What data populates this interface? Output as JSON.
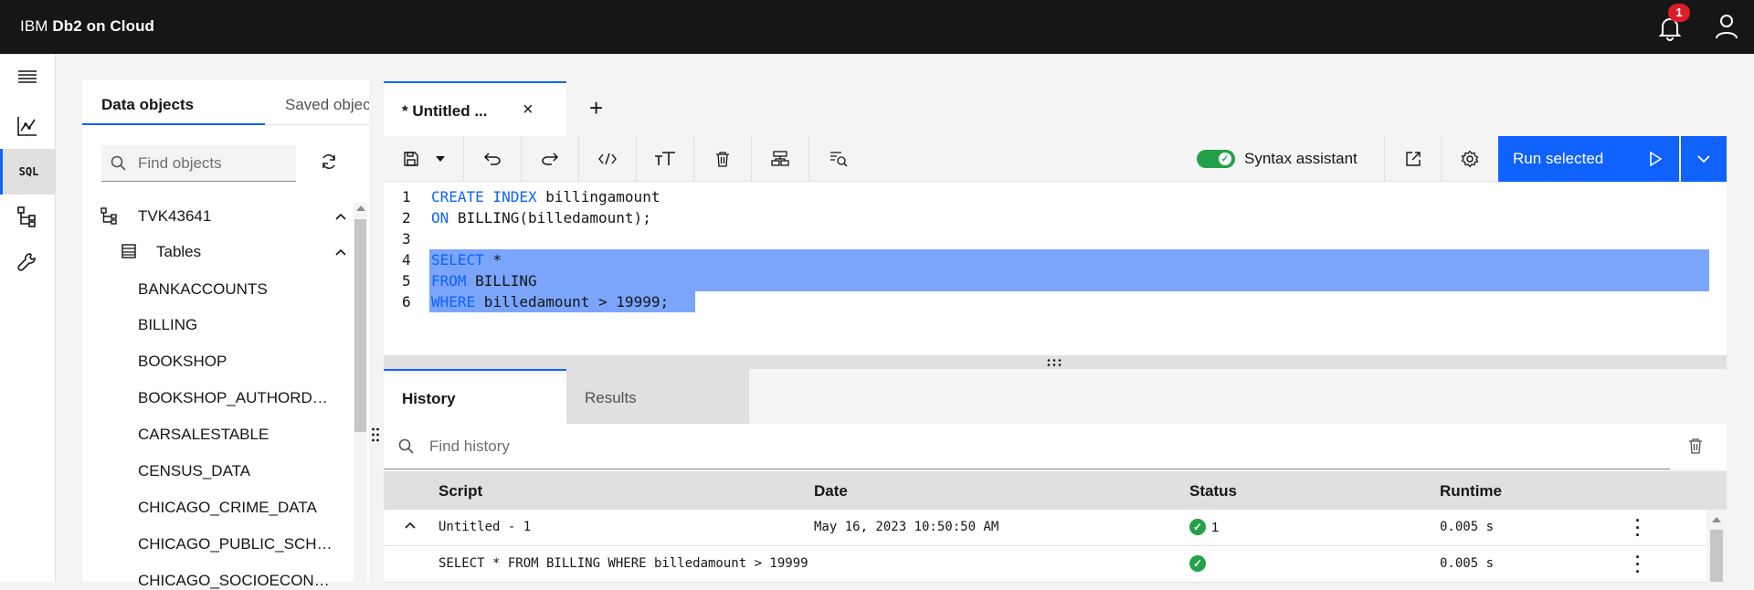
{
  "header": {
    "brand_prefix": "IBM ",
    "brand_bold": "Db2 on Cloud",
    "notification_count": "1"
  },
  "rail": {
    "sql_label": "SQL"
  },
  "left_panel": {
    "tabs": [
      "Data objects",
      "Saved objects"
    ],
    "search_placeholder": "Find objects",
    "schema": "TVK43641",
    "tables_label": "Tables",
    "tables": [
      "BANKACCOUNTS",
      "BILLING",
      "BOOKSHOP",
      "BOOKSHOP_AUTHORDETAILS",
      "CARSALESTABLE",
      "CENSUS_DATA",
      "CHICAGO_CRIME_DATA",
      "CHICAGO_PUBLIC_SCHOOLS",
      "CHICAGO_SOCIOECONOMIC_DATA"
    ]
  },
  "editor_tab": {
    "label": "* Untitled ...",
    "close": "×",
    "add": "+"
  },
  "toolbar": {
    "syntax_assistant": "Syntax assistant",
    "run_label": "Run selected",
    "syntax_assistant_on": true
  },
  "editor": {
    "lines": [
      {
        "num": "1",
        "kw": "CREATE INDEX",
        "rest": " billingamount"
      },
      {
        "num": "2",
        "kw": "ON",
        "rest": " BILLING(billedamount);"
      },
      {
        "num": "3",
        "kw": "",
        "rest": ""
      },
      {
        "num": "4",
        "kw": "SELECT",
        "rest": " *"
      },
      {
        "num": "5",
        "kw": "FROM",
        "rest": " BILLING"
      },
      {
        "num": "6",
        "kw": "WHERE",
        "rest": " billedamount > 19999;"
      }
    ],
    "selected_lines": [
      "4",
      "5",
      "6"
    ]
  },
  "bottom": {
    "tabs": [
      "History",
      "Results"
    ],
    "search_placeholder": "Find history",
    "columns": [
      "Script",
      "Date",
      "Status",
      "Runtime"
    ],
    "rows": [
      {
        "script": "Untitled - 1",
        "date": "May 16, 2023 10:50:50 AM",
        "status": "1",
        "runtime": "0.005 s"
      },
      {
        "script": "SELECT * FROM BILLING WHERE billedamount > 19999",
        "date": "",
        "status": "",
        "runtime": "0.005 s"
      }
    ]
  },
  "colors": {
    "accent": "#0f62fe",
    "success": "#24a148",
    "header_bg": "#161616",
    "selection": "#7aa5fb",
    "badge": "#da1e28"
  }
}
